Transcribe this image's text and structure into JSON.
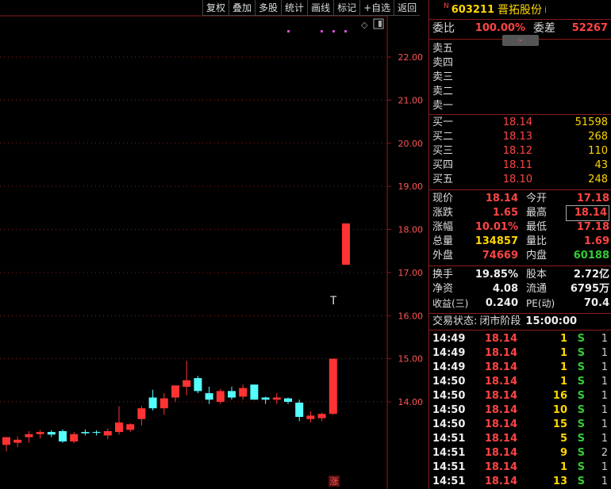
{
  "toolbar": {
    "items": [
      "复权",
      "叠加",
      "多股",
      "统计",
      "画线",
      "标记",
      "+自选",
      "返回"
    ]
  },
  "chart_data": {
    "type": "candlestick",
    "y_ticks": [
      "22.00",
      "21.00",
      "20.00",
      "19.00",
      "18.00",
      "17.00",
      "16.00",
      "15.00",
      "14.00"
    ],
    "ylim": [
      12.0,
      22.5
    ],
    "candles": [
      {
        "o": 13.0,
        "h": 13.15,
        "l": 12.85,
        "c": 13.18
      },
      {
        "o": 13.05,
        "h": 13.2,
        "l": 12.95,
        "c": 13.12
      },
      {
        "o": 13.18,
        "h": 13.32,
        "l": 13.05,
        "c": 13.25
      },
      {
        "o": 13.25,
        "h": 13.35,
        "l": 13.15,
        "c": 13.3
      },
      {
        "o": 13.3,
        "h": 13.34,
        "l": 13.18,
        "c": 13.24
      },
      {
        "o": 13.32,
        "h": 13.36,
        "l": 13.05,
        "c": 13.08
      },
      {
        "o": 13.08,
        "h": 13.3,
        "l": 13.04,
        "c": 13.25
      },
      {
        "o": 13.3,
        "h": 13.36,
        "l": 13.22,
        "c": 13.27
      },
      {
        "o": 13.3,
        "h": 13.34,
        "l": 13.22,
        "c": 13.28
      },
      {
        "o": 13.22,
        "h": 13.38,
        "l": 13.13,
        "c": 13.32
      },
      {
        "o": 13.3,
        "h": 13.9,
        "l": 13.24,
        "c": 13.52
      },
      {
        "o": 13.35,
        "h": 13.5,
        "l": 13.3,
        "c": 13.48
      },
      {
        "o": 13.6,
        "h": 13.9,
        "l": 13.45,
        "c": 13.85
      },
      {
        "o": 14.1,
        "h": 14.28,
        "l": 13.8,
        "c": 13.85
      },
      {
        "o": 13.85,
        "h": 14.2,
        "l": 13.7,
        "c": 14.08
      },
      {
        "o": 14.1,
        "h": 14.3,
        "l": 14.0,
        "c": 14.38
      },
      {
        "o": 14.35,
        "h": 14.95,
        "l": 14.15,
        "c": 14.5
      },
      {
        "o": 14.55,
        "h": 14.6,
        "l": 14.2,
        "c": 14.25
      },
      {
        "o": 14.2,
        "h": 14.35,
        "l": 13.95,
        "c": 14.05
      },
      {
        "o": 14.0,
        "h": 14.3,
        "l": 13.95,
        "c": 14.25
      },
      {
        "o": 14.25,
        "h": 14.35,
        "l": 14.05,
        "c": 14.1
      },
      {
        "o": 14.12,
        "h": 14.4,
        "l": 14.05,
        "c": 14.32
      },
      {
        "o": 14.4,
        "h": 14.4,
        "l": 14.05,
        "c": 14.05
      },
      {
        "o": 14.1,
        "h": 14.12,
        "l": 13.95,
        "c": 14.05
      },
      {
        "o": 14.05,
        "h": 14.2,
        "l": 13.95,
        "c": 14.1
      },
      {
        "o": 14.08,
        "h": 14.1,
        "l": 13.95,
        "c": 14.0
      },
      {
        "o": 13.98,
        "h": 14.05,
        "l": 13.55,
        "c": 13.65
      },
      {
        "o": 13.6,
        "h": 13.78,
        "l": 13.52,
        "c": 13.68
      },
      {
        "o": 13.62,
        "h": 13.75,
        "l": 13.55,
        "c": 13.72
      },
      {
        "o": 13.72,
        "h": 15.0,
        "l": 13.7,
        "c": 15.0
      },
      {
        "o": 17.18,
        "h": 18.14,
        "l": 17.18,
        "c": 18.14
      }
    ],
    "colors": {
      "up": "#ff3333",
      "down": "#55ffff"
    }
  },
  "chart_labels": {
    "zhang": "涨",
    "cursor": "T",
    "top_icons": [
      "◇",
      "▐"
    ]
  },
  "panel": {
    "title": {
      "badge": "N",
      "code": "603211",
      "name": "晋拓股份",
      "suffix": "i"
    },
    "weibi": {
      "label1": "委比",
      "value1": "100.00%",
      "label2": "委差",
      "value2": "52267"
    },
    "collapse": "⌄",
    "sells": [
      {
        "label": "卖五",
        "price": "",
        "vol": ""
      },
      {
        "label": "卖四",
        "price": "",
        "vol": ""
      },
      {
        "label": "卖三",
        "price": "",
        "vol": ""
      },
      {
        "label": "卖二",
        "price": "",
        "vol": ""
      },
      {
        "label": "卖一",
        "price": "",
        "vol": ""
      }
    ],
    "buys": [
      {
        "label": "买一",
        "price": "18.14",
        "vol": "51598"
      },
      {
        "label": "买二",
        "price": "18.13",
        "vol": "268"
      },
      {
        "label": "买三",
        "price": "18.12",
        "vol": "110"
      },
      {
        "label": "买四",
        "price": "18.11",
        "vol": "43"
      },
      {
        "label": "买五",
        "price": "18.10",
        "vol": "248"
      }
    ],
    "quote1": [
      {
        "l1": "现价",
        "v1": "18.14",
        "c1": "red",
        "l2": "今开",
        "v2": "17.18",
        "c2": "red"
      },
      {
        "l1": "涨跌",
        "v1": "1.65",
        "c1": "red",
        "l2": "最高",
        "v2": "18.14",
        "c2": "red"
      },
      {
        "l1": "涨幅",
        "v1": "10.01%",
        "c1": "red",
        "l2": "最低",
        "v2": "17.18",
        "c2": "red"
      },
      {
        "l1": "总量",
        "v1": "134857",
        "c1": "yellow",
        "l2": "量比",
        "v2": "1.69",
        "c2": "red"
      },
      {
        "l1": "外盘",
        "v1": "74669",
        "c1": "red",
        "l2": "内盘",
        "v2": "60188",
        "c2": "green"
      }
    ],
    "quote2": [
      {
        "l1": "换手",
        "v1": "19.85%",
        "c1": "white",
        "l2": "股本",
        "v2": "2.72亿",
        "c2": "white"
      },
      {
        "l1": "净资",
        "v1": "4.08",
        "c1": "white",
        "l2": "流通",
        "v2": "6795万",
        "c2": "white"
      },
      {
        "l1": "收益(三)",
        "v1": "0.240",
        "c1": "white",
        "l2": "PE(动)",
        "v2": "70.4",
        "c2": "white"
      }
    ],
    "status": {
      "label": "交易状态:",
      "value": "闭市阶段",
      "time": "15:00:00"
    },
    "ticks": [
      {
        "t": "14:49",
        "p": "18.14",
        "v": "1",
        "d": "S",
        "n": "1"
      },
      {
        "t": "14:49",
        "p": "18.14",
        "v": "1",
        "d": "S",
        "n": "1"
      },
      {
        "t": "14:49",
        "p": "18.14",
        "v": "1",
        "d": "S",
        "n": "1"
      },
      {
        "t": "14:50",
        "p": "18.14",
        "v": "1",
        "d": "S",
        "n": "1"
      },
      {
        "t": "14:50",
        "p": "18.14",
        "v": "16",
        "d": "S",
        "n": "1"
      },
      {
        "t": "14:50",
        "p": "18.14",
        "v": "10",
        "d": "S",
        "n": "1"
      },
      {
        "t": "14:50",
        "p": "18.14",
        "v": "15",
        "d": "S",
        "n": "1"
      },
      {
        "t": "14:51",
        "p": "18.14",
        "v": "5",
        "d": "S",
        "n": "1"
      },
      {
        "t": "14:51",
        "p": "18.14",
        "v": "9",
        "d": "S",
        "n": "2"
      },
      {
        "t": "14:51",
        "p": "18.14",
        "v": "1",
        "d": "S",
        "n": "1"
      },
      {
        "t": "14:51",
        "p": "18.14",
        "v": "13",
        "d": "S",
        "n": "1"
      }
    ]
  }
}
